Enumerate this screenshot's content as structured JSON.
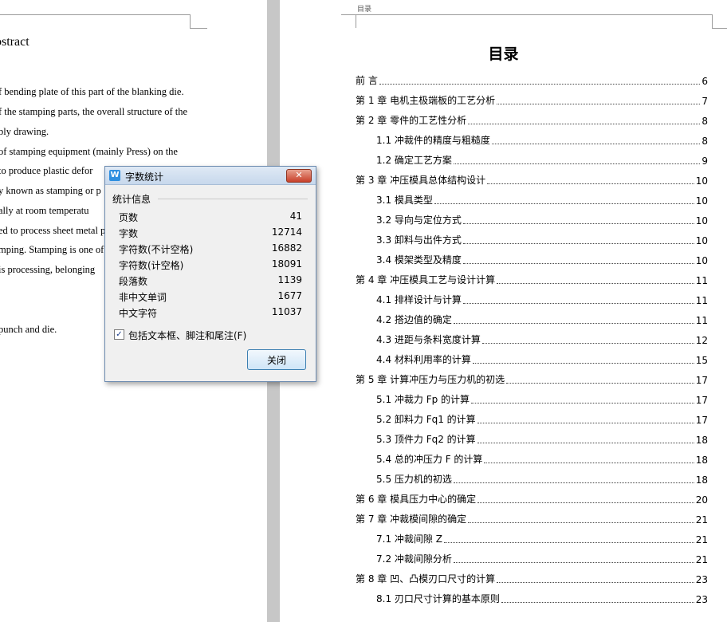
{
  "left_page": {
    "title": "bstract",
    "lines": [
      "f bending plate of this part of the blanking die.",
      "f the stamping parts, the overall structure of the",
      "bly drawing.",
      "of  stamping  equipment  (mainly  Press)  on  the",
      "  to produce plastic defor",
      "y known as stamping or p",
      "ally  at  room  temperatu",
      "ed to process sheet metal p",
      "mping. Stamping is one of",
      "is  processing,  belonging",
      "punch and die."
    ]
  },
  "dialog": {
    "title": "字数统计",
    "app_icon": "W",
    "close_glyph": "✕",
    "group_label": "统计信息",
    "stats": [
      {
        "label": "页数",
        "value": "41"
      },
      {
        "label": "字数",
        "value": "12714"
      },
      {
        "label": "字符数(不计空格)",
        "value": "16882"
      },
      {
        "label": "字符数(计空格)",
        "value": "18091"
      },
      {
        "label": "段落数",
        "value": "1139"
      },
      {
        "label": "非中文单词",
        "value": "1677"
      },
      {
        "label": "中文字符",
        "value": "11037"
      }
    ],
    "checkbox_label": "包括文本框、脚注和尾注(F)",
    "checkbox_checked": true,
    "checkbox_glyph": "✓",
    "close_button": "关闭"
  },
  "right_page": {
    "header_text": "目录",
    "title": "目录",
    "entries": [
      {
        "text": "前  言",
        "page": "6",
        "level": 1
      },
      {
        "text": "第 1 章  电机主极端板的工艺分析",
        "page": "7",
        "level": 1
      },
      {
        "text": "第 2 章  零件的工艺性分析",
        "page": "8",
        "level": 1
      },
      {
        "text": "1.1 冲裁件的精度与粗糙度",
        "page": "8",
        "level": 2
      },
      {
        "text": "1.2 确定工艺方案",
        "page": "9",
        "level": 2
      },
      {
        "text": "第 3 章  冲压模具总体结构设计",
        "page": "10",
        "level": 1
      },
      {
        "text": "3.1 模具类型",
        "page": "10",
        "level": 2
      },
      {
        "text": "3.2 导向与定位方式",
        "page": "10",
        "level": 2
      },
      {
        "text": "3.3 卸料与出件方式",
        "page": "10",
        "level": 2
      },
      {
        "text": "3.4 模架类型及精度",
        "page": "10",
        "level": 2
      },
      {
        "text": "第 4 章  冲压模具工艺与设计计算",
        "page": "11",
        "level": 1
      },
      {
        "text": "4.1 排样设计与计算",
        "page": "11",
        "level": 2
      },
      {
        "text": "4.2 搭边值的确定",
        "page": "11",
        "level": 2
      },
      {
        "text": "4.3 进距与条料宽度计算",
        "page": "12",
        "level": 2
      },
      {
        "text": "4.4 材料利用率的计算",
        "page": "15",
        "level": 2
      },
      {
        "text": "第 5 章  计算冲压力与压力机的初选",
        "page": "17",
        "level": 1
      },
      {
        "text": "5.1 冲裁力 Fp 的计算",
        "page": "17",
        "level": 2
      },
      {
        "text": "5.2 卸料力 Fq1 的计算",
        "page": "17",
        "level": 2
      },
      {
        "text": "5.3 顶件力 Fq2 的计算",
        "page": "18",
        "level": 2
      },
      {
        "text": "5.4 总的冲压力 F 的计算",
        "page": "18",
        "level": 2
      },
      {
        "text": "5.5 压力机的初选",
        "page": "18",
        "level": 2
      },
      {
        "text": "第 6 章  模具压力中心的确定",
        "page": "20",
        "level": 1
      },
      {
        "text": "第 7 章  冲裁模间隙的确定",
        "page": "21",
        "level": 1
      },
      {
        "text": "7.1 冲裁间隙 Z",
        "page": "21",
        "level": 2
      },
      {
        "text": "7.2 冲裁间隙分析",
        "page": "21",
        "level": 2
      },
      {
        "text": "第 8 章  凹、凸模刃口尺寸的计算",
        "page": "23",
        "level": 1
      },
      {
        "text": "8.1 刃口尺寸计算的基本原则",
        "page": "23",
        "level": 2
      }
    ]
  }
}
